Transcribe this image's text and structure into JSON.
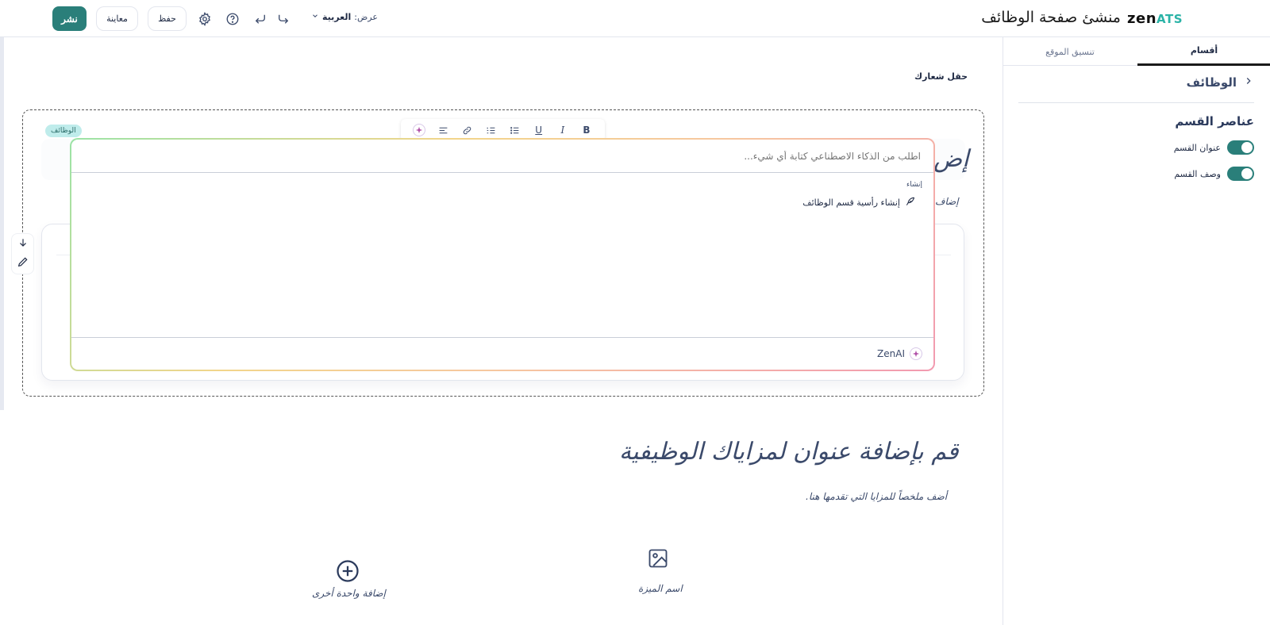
{
  "app": {
    "brand_main": "zen",
    "brand_suffix": "ATS",
    "title": "منشئ صفحة الوظائف"
  },
  "toolbar": {
    "publish_label": "نشر",
    "preview_label": "معاينة",
    "save_label": "حفظ",
    "view_label": "عرض:",
    "view_value": "العربية",
    "icons": [
      "gear-icon",
      "help-icon",
      "undo-icon",
      "redo-icon"
    ]
  },
  "panel": {
    "tabs": [
      {
        "label": "أقسام",
        "active": true
      },
      {
        "label": "تنسيق الموقع",
        "active": false
      }
    ],
    "back_label": "الوظائف",
    "section_heading": "عناصر القسم",
    "toggles": [
      {
        "label": "عنوان القسم",
        "on": true
      },
      {
        "label": "وصف القسم",
        "on": true
      }
    ]
  },
  "canvas": {
    "logo_field": "حقل شعارك",
    "jobs_badge": "الوظائف",
    "behind_title": "إض",
    "behind_subtitle": "إضاف"
  },
  "ai": {
    "prompt_placeholder": "اطلب من الذكاء الاصطناعي كتابة أي شيء...",
    "group_label": "إنشاء",
    "option_label": "إنشاء رأسية قسم الوظائف",
    "footer_label": "ZenAI"
  },
  "format_toolbar": {
    "bold": "B",
    "italic": "I",
    "underline": "U"
  },
  "benefits": {
    "title": "قم بإضافة عنوان لمزاياك الوظيفية",
    "subtitle": "أضف ملخصاً للمزايا التي تقدمها هنا.",
    "item_name": "اسم الميزة",
    "add_label": "إضافة واحدة أخرى"
  },
  "colors": {
    "accent": "#2a7f7a",
    "badge_bg": "#bfeceb",
    "text_dark": "#1f2a44",
    "text_muted": "#3b4a6b"
  }
}
